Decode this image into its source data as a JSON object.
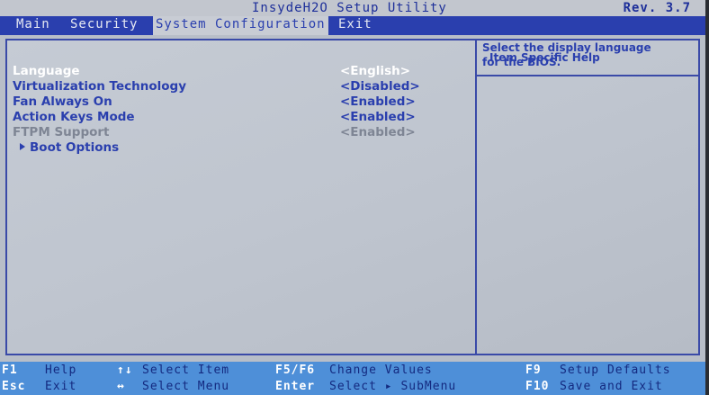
{
  "window": {
    "title": "InsydeH2O Setup Utility",
    "revision": "Rev. 3.7"
  },
  "menu": {
    "items": [
      {
        "label": "Main",
        "active": false
      },
      {
        "label": "Security",
        "active": false
      },
      {
        "label": "System Configuration",
        "active": true
      },
      {
        "label": "Exit",
        "active": false
      }
    ]
  },
  "settings": [
    {
      "label": "Language",
      "value": "<English>",
      "state": "selected"
    },
    {
      "label": "Virtualization Technology",
      "value": "<Disabled>",
      "state": "normal"
    },
    {
      "label": "Fan Always On",
      "value": "<Enabled>",
      "state": "normal"
    },
    {
      "label": "Action Keys Mode",
      "value": "<Enabled>",
      "state": "normal"
    },
    {
      "label": "FTPM Support",
      "value": "<Enabled>",
      "state": "disabled"
    },
    {
      "label": "Boot Options",
      "value": "",
      "state": "submenu"
    }
  ],
  "help": {
    "header": "Item Specific Help",
    "lines": [
      "Select the display language",
      "for the BIOS."
    ]
  },
  "keys": {
    "f1": {
      "key": "F1",
      "desc": "Help"
    },
    "esc": {
      "key": "Esc",
      "desc": "Exit"
    },
    "updown": {
      "key": "↑↓",
      "desc": "Select Item"
    },
    "leftright": {
      "key": "↔",
      "desc": "Select Menu"
    },
    "f5f6": {
      "key": "F5/F6",
      "desc": "Change Values"
    },
    "enter": {
      "key": "Enter",
      "desc": "Select ▸ SubMenu"
    },
    "f9": {
      "key": "F9",
      "desc": "Setup Defaults"
    },
    "f10": {
      "key": "F10",
      "desc": "Save and Exit"
    }
  },
  "colors": {
    "menu_bar": "#2a3fae",
    "text_blue": "#2a3fae",
    "highlight_white": "#ffffff",
    "disabled_gray": "#7e8594",
    "key_bar": "#4e8fd8",
    "background": "#bfc5cf"
  }
}
